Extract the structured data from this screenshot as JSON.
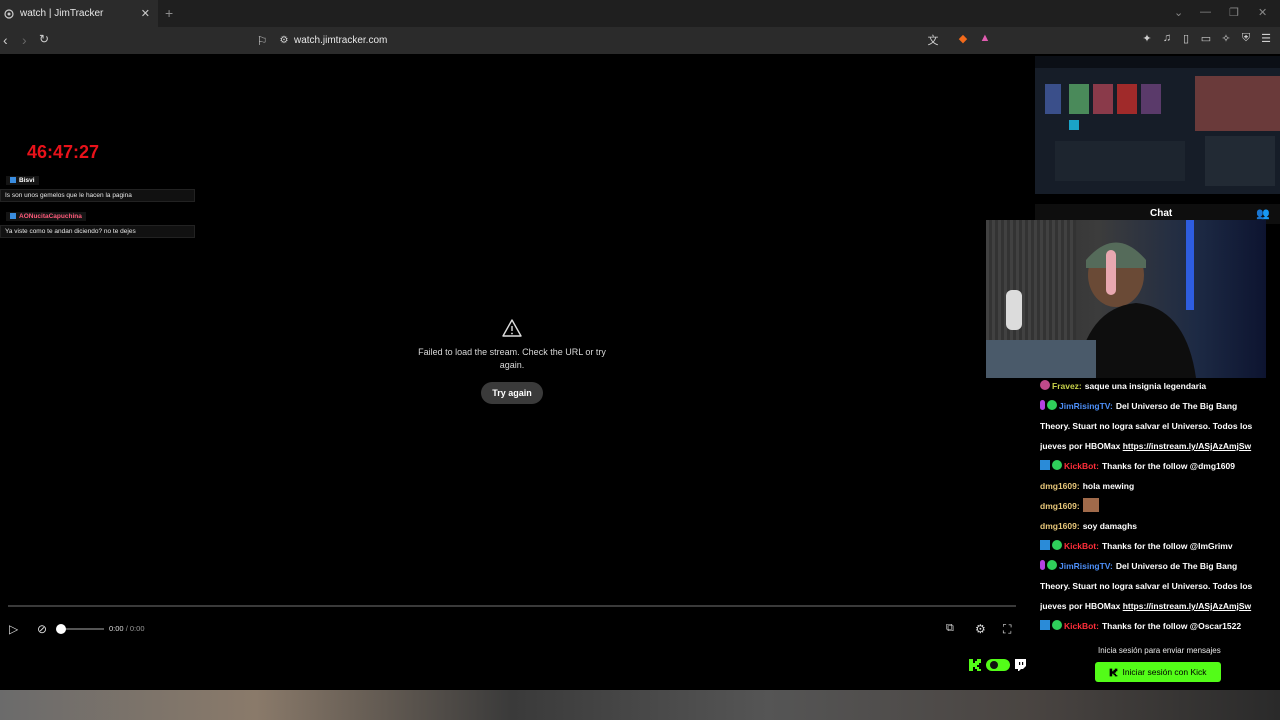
{
  "browser": {
    "tab_title": "watch | JimTracker",
    "url": "watch.jimtracker.com"
  },
  "overlay": {
    "timer": "46:47:27",
    "messages": [
      {
        "user": "Bisvi",
        "text": "Is son unos gemelos que le hacen la pagina"
      },
      {
        "user": "AONucitaCapuchina",
        "text": "Ya viste como te andan diciendo? no te dejes"
      }
    ]
  },
  "player": {
    "error_text": "Failed to load the stream. Check the URL or try again.",
    "retry_label": "Try again",
    "time_current": "0:00",
    "time_separator": "/",
    "time_total": "0:00"
  },
  "chat": {
    "title": "Chat",
    "lines": [
      {
        "user": "Fravez:",
        "text": "saque una insignia legendaria",
        "color": "#c9d24a"
      },
      {
        "user": "JimRisingTV:",
        "text": "Del Universo de The Big Bang",
        "color": "#4d8ff7"
      },
      {
        "user": "",
        "text": "Theory. Stuart no logra salvar el Universo. Todos los",
        "color": "#fff"
      },
      {
        "user": "",
        "text": "jueves por HBOMax",
        "link": "https://instream.ly/ASjAzAmjSw",
        "color": "#fff"
      },
      {
        "user": "KickBot:",
        "text": "Thanks for the follow @dmg1609",
        "color": "#ff2e3a"
      },
      {
        "user": "dmg1609:",
        "text": "hola mewing",
        "color": "#e8c77a"
      },
      {
        "user": "dmg1609:",
        "text": "",
        "color": "#e8c77a"
      },
      {
        "user": "dmg1609:",
        "text": "soy damaghs",
        "color": "#e8c77a"
      },
      {
        "user": "KickBot:",
        "text": "Thanks for the follow @ImGrimv",
        "color": "#ff2e3a"
      },
      {
        "user": "JimRisingTV:",
        "text": "Del Universo de The Big Bang",
        "color": "#4d8ff7"
      },
      {
        "user": "",
        "text": "Theory. Stuart no logra salvar el Universo. Todos los",
        "color": "#fff"
      },
      {
        "user": "",
        "text": "jueves por HBOMax",
        "link": "https://instream.ly/ASjAzAmjSw",
        "color": "#fff"
      },
      {
        "user": "KickBot:",
        "text": "Thanks for the follow @Oscar1522",
        "color": "#ff2e3a"
      }
    ],
    "login_msg": "Inicia sesión para enviar mensajes",
    "login_btn": "Iniciar sesión con Kick"
  },
  "colors": {
    "timer": "#e8121a",
    "kick_green": "#53fc18"
  }
}
